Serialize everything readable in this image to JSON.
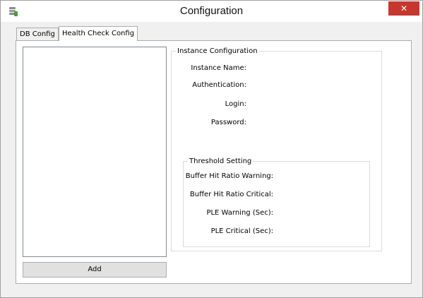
{
  "window": {
    "title": "Configuration",
    "close_glyph": "✕"
  },
  "tabs": [
    {
      "label": "DB Config",
      "active": false
    },
    {
      "label": "Health Check Config",
      "active": true
    }
  ],
  "instance_group": {
    "legend": "Instance Configuration",
    "fields": [
      {
        "label": "Instance Name:"
      },
      {
        "label": "Authentication:"
      },
      {
        "label": "Login:"
      },
      {
        "label": "Password:"
      }
    ]
  },
  "threshold_group": {
    "legend": "Threshold Setting",
    "fields": [
      {
        "label": "Buffer Hit Ratio Warning:"
      },
      {
        "label": "Buffer Hit Ratio Critical:"
      },
      {
        "label": "PLE Warning (Sec):"
      },
      {
        "label": "PLE Critical (Sec):"
      }
    ]
  },
  "buttons": {
    "add_label": "Add"
  },
  "icons": {
    "app": "database-icon",
    "close": "close-icon"
  }
}
